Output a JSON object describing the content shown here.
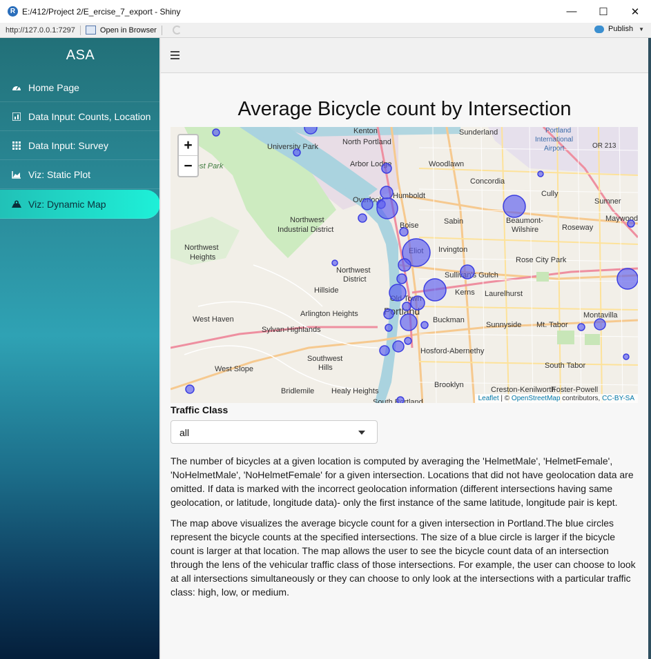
{
  "window": {
    "title": "E:/412/Project 2/E_ercise_7_export - Shiny",
    "app_icon_letter": "R",
    "minimize": "—",
    "maximize": "☐",
    "close": "✕"
  },
  "toolbar": {
    "url": "http://127.0.0.1:7297",
    "open_browser": "Open in Browser",
    "publish": "Publish"
  },
  "sidebar": {
    "brand": "ASA",
    "items": [
      {
        "label": "Home Page",
        "icon": "dashboard-icon",
        "active": false
      },
      {
        "label": "Data Input: Counts, Location",
        "icon": "bar-chart-icon",
        "active": false
      },
      {
        "label": "Data Input: Survey",
        "icon": "grid-icon",
        "active": false
      },
      {
        "label": "Viz: Static Plot",
        "icon": "area-chart-icon",
        "active": false
      },
      {
        "label": "Viz: Dynamic Map",
        "icon": "map-marker-icon",
        "active": true
      }
    ]
  },
  "main": {
    "title": "Average Bicycle count by Intersection",
    "map": {
      "zoom_in": "+",
      "zoom_out": "−",
      "attribution": {
        "leaflet": "Leaflet",
        "sep": " | © ",
        "osm": "OpenStreetMap",
        "contrib": " contributors, ",
        "license": "CC-BY-SA"
      },
      "place_labels": [
        "Kenton",
        "Sunderland",
        "Portland International Airport",
        "University Park",
        "North Portland",
        "Arbor Lodge",
        "Woodlawn",
        "Concordia",
        "Cully",
        "Sumner",
        "Maywood",
        "Overlook",
        "Humboldt",
        "Boise",
        "Sabin",
        "Beaumont-Wilshire",
        "Roseway",
        "Northwest Industrial District",
        "Eliot",
        "Irvington",
        "Northwest Heights",
        "Rose City Park",
        "Northwest District",
        "Sullivan's Gulch",
        "Hillside",
        "Old Town",
        "Kerns",
        "Laurelhurst",
        "Portland",
        "West Haven",
        "Arlington Heights",
        "Buckman",
        "Sunnyside",
        "Mt. Tabor",
        "Montavilla",
        "Sylvan-Highlands",
        "Hosford-Abernethy",
        "Southwest Hills",
        "West Slope",
        "South Tabor",
        "Bridlemile",
        "Healy Heights",
        "Brooklyn",
        "Creston-Kenilworth",
        "Foster-Powell",
        "South Portland",
        "est Park",
        "OR 213"
      ]
    },
    "traffic_class_label": "Traffic Class",
    "traffic_class_value": "all",
    "paragraph1": "The number of bicycles at a given location is computed by averaging the 'HelmetMale', 'HelmetFemale', 'NoHelmetMale', 'NoHelmetFemale' for a given intersection. Locations that did not have geolocation data are omitted. If data is marked with the incorrect geolocation information (different intersections having same geolocation, or latitude, longitude data)- only the first instance of the same latitude, longitude pair is kept.",
    "paragraph2": "The map above visualizes the average bicycle count for a given intersection in Portland.The blue circles represent the bicycle counts at the specified intersections. The size of a blue circle is larger if the bicycle count is larger at that location. The map allows the user to see the bicycle count data of an intersection through the lens of the vehicular traffic class of those intersections. For example, the user can choose to look at all intersections simultaneously or they can choose to only look at the intersections with a particular traffic class: high, low, or medium."
  },
  "colors": {
    "circle_fill": "#5a5cf0",
    "park_green": "#c8e6b8",
    "river": "#aad3df",
    "sidebar_active": "#1ef0d8"
  }
}
